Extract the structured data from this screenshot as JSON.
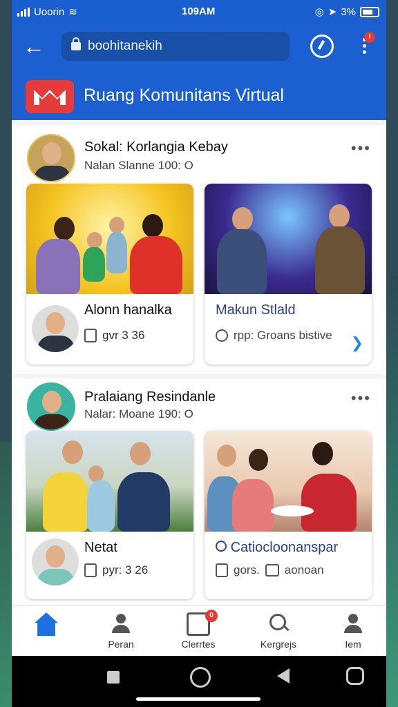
{
  "status_bar": {
    "carrier": "Uoorin",
    "time": "109AM",
    "battery_text": "3%"
  },
  "app_bar": {
    "url_text": "boohitanekih",
    "more_badge": "!",
    "brand_title": "Ruang Komunitans Virtual"
  },
  "posts": [
    {
      "title": "Sokal: Korlangia Kebay",
      "meta": "Nalan Slanne 100: O",
      "cards": [
        {
          "title": "Alonn hanalka",
          "meta": "gvr 3 36"
        },
        {
          "title": "Makun Stlald",
          "meta": "rpp: Groans bistive"
        }
      ]
    },
    {
      "title": "Pralaiang Resindanle",
      "meta": "Nalar: Moane 190: O",
      "cards": [
        {
          "title": "Netat",
          "meta": "pyr: 3 26"
        },
        {
          "title": "Catiocloonanspar",
          "meta_a": "gors.",
          "meta_b": "aonoan"
        }
      ]
    }
  ],
  "bottom_nav": {
    "items": [
      {
        "label": "",
        "icon": "home-icon"
      },
      {
        "label": "Peran",
        "icon": "people-icon"
      },
      {
        "label": "Clerrtes",
        "icon": "document-icon",
        "badge": "0"
      },
      {
        "label": "Kergrejs",
        "icon": "search-icon"
      },
      {
        "label": "Iem",
        "icon": "profile-icon"
      }
    ]
  },
  "colors": {
    "primary": "#1c5fd0",
    "badge": "#e53935",
    "brand": "#e63b3b"
  }
}
